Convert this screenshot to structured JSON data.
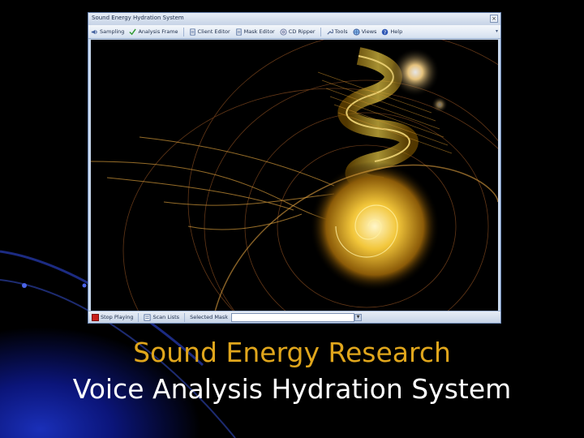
{
  "window": {
    "title": "Sound Energy Hydration System",
    "close_glyph": "×"
  },
  "toolbar": {
    "items": [
      {
        "label": "Sampling",
        "icon": "speaker-icon"
      },
      {
        "label": "Analysis Frame",
        "icon": "checkmark-icon"
      },
      {
        "label": "Client Editor",
        "icon": "document-icon"
      },
      {
        "label": "Mask Editor",
        "icon": "document-icon"
      },
      {
        "label": "CD Ripper",
        "icon": "disc-icon"
      },
      {
        "label": "Tools",
        "icon": "wrench-icon"
      },
      {
        "label": "Views",
        "icon": "globe-icon"
      },
      {
        "label": "Help",
        "icon": "help-icon"
      }
    ]
  },
  "statusbar": {
    "stop_label": "Stop Playing",
    "scan_label": "Scan Lists",
    "mask_label": "Selected Mask",
    "mask_value": ""
  },
  "caption": {
    "line1": "Sound Energy Research",
    "line2": "Voice Analysis Hydration System"
  },
  "colors": {
    "caption_accent": "#e0a61c",
    "caption_text": "#ffffff",
    "window_chrome": "#c9d9ee"
  }
}
